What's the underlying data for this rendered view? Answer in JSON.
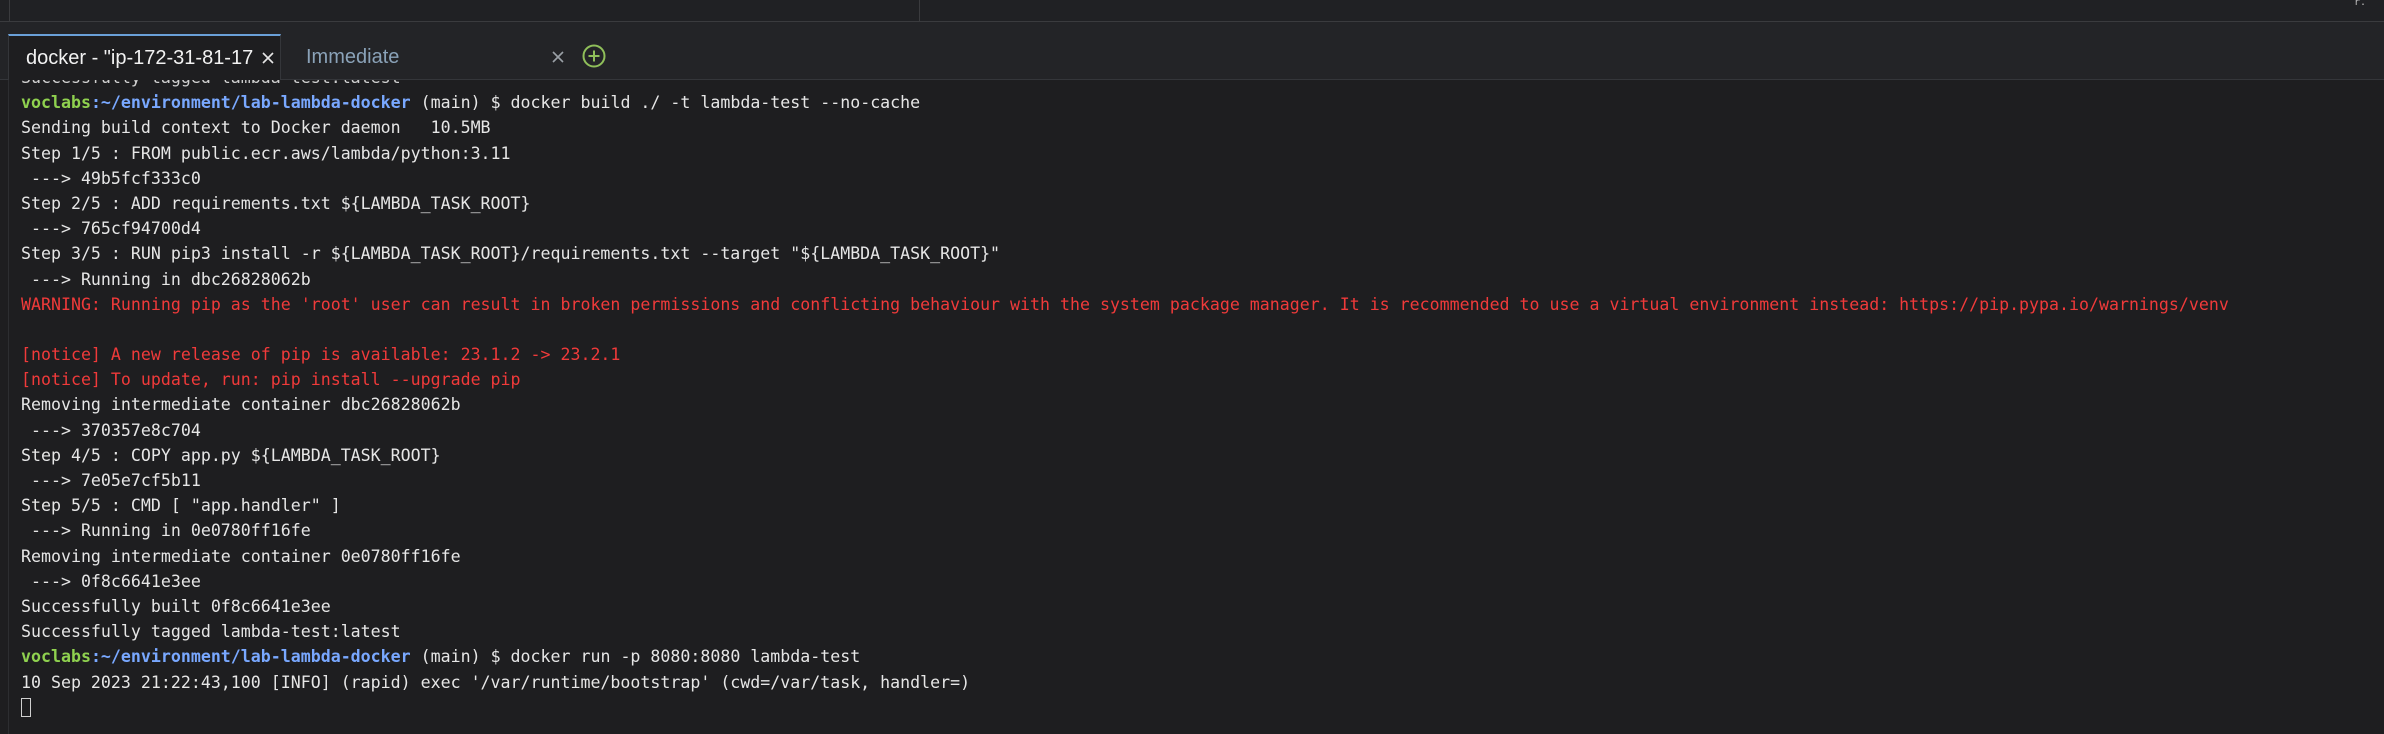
{
  "window": {
    "corner_mark": "r.l"
  },
  "tabs": [
    {
      "title": "docker - \"ip-172-31-81-17",
      "active": true
    },
    {
      "title": "Immediate",
      "active": false
    }
  ],
  "icons": {
    "close": "close-icon",
    "add": "plus-circle-icon"
  },
  "colors": {
    "error_text": "#f03a3a",
    "prompt_user": "#8fd14f",
    "prompt_path": "#79a8ff",
    "add_icon": "#8fbf5a",
    "active_tab_accent": "#6aa0d8"
  },
  "terminal": {
    "clipped_top": "Successfully tagged lambda-test:latest",
    "prompt_user": "voclabs",
    "prompt_path": ":~/environment/lab-lambda-docker",
    "prompt_branch": " (main) $ ",
    "cmd_build": "docker build ./ -t lambda-test --no-cache",
    "cmd_run": "docker run -p 8080:8080 lambda-test",
    "output1": [
      "Sending build context to Docker daemon   10.5MB",
      "Step 1/5 : FROM public.ecr.aws/lambda/python:3.11",
      " ---> 49b5fcf333c0",
      "Step 2/5 : ADD requirements.txt ${LAMBDA_TASK_ROOT}",
      " ---> 765cf94700d4",
      "Step 3/5 : RUN pip3 install -r ${LAMBDA_TASK_ROOT}/requirements.txt --target \"${LAMBDA_TASK_ROOT}\"",
      " ---> Running in dbc26828062b"
    ],
    "warning": "WARNING: Running pip as the 'root' user can result in broken permissions and conflicting behaviour with the system package manager. It is recommended to use a virtual environment instead: https://pip.pypa.io/warnings/venv",
    "notice1": "[notice] A new release of pip is available: 23.1.2 -> 23.2.1",
    "notice2": "[notice] To update, run: pip install --upgrade pip",
    "output2": [
      "Removing intermediate container dbc26828062b",
      " ---> 370357e8c704",
      "Step 4/5 : COPY app.py ${LAMBDA_TASK_ROOT}",
      " ---> 7e05e7cf5b11",
      "Step 5/5 : CMD [ \"app.handler\" ]",
      " ---> Running in 0e0780ff16fe",
      "Removing intermediate container 0e0780ff16fe",
      " ---> 0f8c6641e3ee",
      "Successfully built 0f8c6641e3ee",
      "Successfully tagged lambda-test:latest"
    ],
    "run_output": "10 Sep 2023 21:22:43,100 [INFO] (rapid) exec '/var/runtime/bootstrap' (cwd=/var/task, handler=)"
  }
}
